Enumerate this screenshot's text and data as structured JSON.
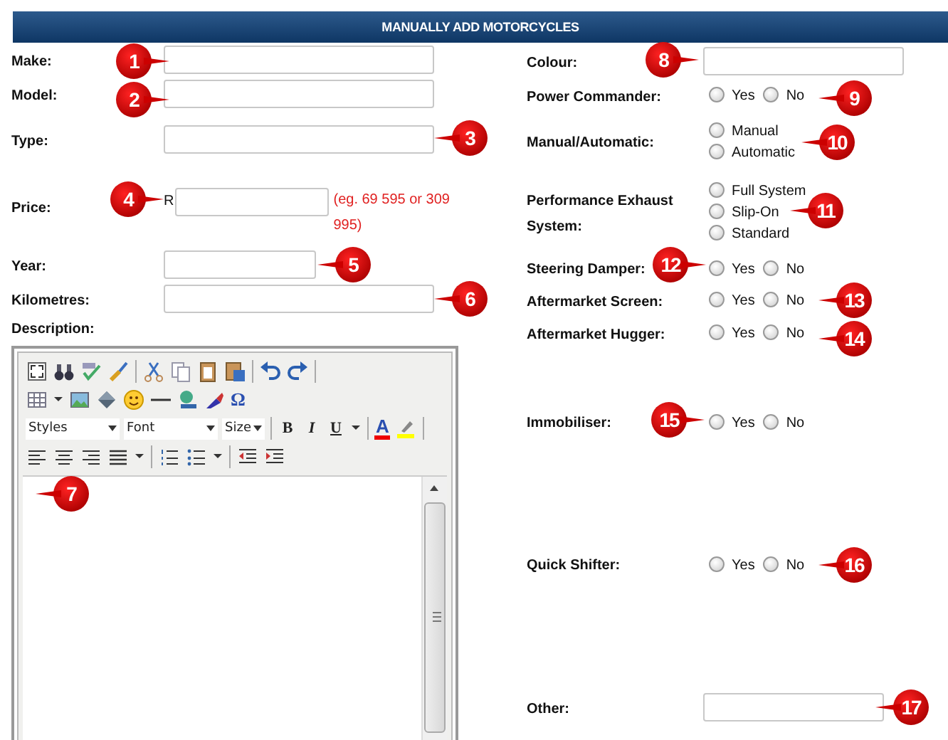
{
  "header": {
    "title": "MANUALLY ADD MOTORCYCLES"
  },
  "left_fields": [
    {
      "label": "Make:",
      "kind": "text"
    },
    {
      "label": "Model:",
      "kind": "text"
    },
    {
      "label": "Type:",
      "kind": "text"
    },
    {
      "label": "Price:",
      "kind": "price",
      "prefix": "R",
      "hint": "(eg. 69 595 or 309 995)"
    },
    {
      "label": "Year:",
      "kind": "text"
    },
    {
      "label": "Kilometres:",
      "kind": "text"
    },
    {
      "label": "Description:",
      "kind": "editor"
    }
  ],
  "editor": {
    "dropdowns": [
      "Styles",
      "Font",
      "Size"
    ],
    "format_buttons": [
      "B",
      "I",
      "U"
    ],
    "font_color": "A",
    "special_char": "Ω"
  },
  "right_fields": [
    {
      "label": "Colour:",
      "kind": "text"
    },
    {
      "label": "Power Commander:",
      "kind": "radio",
      "options": [
        {
          "label": "Yes",
          "selected": false
        },
        {
          "label": "No",
          "selected": false
        }
      ]
    },
    {
      "label": "Manual/Automatic:",
      "kind": "radio-stack",
      "options": [
        {
          "label": "Manual",
          "selected": false
        },
        {
          "label": "Automatic",
          "selected": false
        }
      ]
    },
    {
      "label": "Performance Exhaust System:",
      "kind": "radio-stack",
      "options": [
        {
          "label": "Full System",
          "selected": false
        },
        {
          "label": "Slip-On",
          "selected": false
        },
        {
          "label": "Standard",
          "selected": false
        }
      ]
    },
    {
      "label": "Steering Damper:",
      "kind": "radio",
      "options": [
        {
          "label": "Yes",
          "selected": false
        },
        {
          "label": "No",
          "selected": false
        }
      ]
    },
    {
      "label": "Aftermarket Screen:",
      "kind": "radio",
      "options": [
        {
          "label": "Yes",
          "selected": false
        },
        {
          "label": "No",
          "selected": false
        }
      ]
    },
    {
      "label": "Aftermarket Hugger:",
      "kind": "radio",
      "options": [
        {
          "label": "Yes",
          "selected": false
        },
        {
          "label": "No",
          "selected": false
        }
      ]
    },
    {
      "label": "Immobiliser:",
      "kind": "radio",
      "options": [
        {
          "label": "Yes",
          "selected": false
        },
        {
          "label": "No",
          "selected": false
        }
      ]
    },
    {
      "label": "Quick Shifter:",
      "kind": "radio",
      "options": [
        {
          "label": "Yes",
          "selected": false
        },
        {
          "label": "No",
          "selected": false
        }
      ]
    },
    {
      "label": "Other:",
      "kind": "text"
    }
  ],
  "callouts": [
    {
      "number": "1"
    },
    {
      "number": "2"
    },
    {
      "number": "3"
    },
    {
      "number": "4"
    },
    {
      "number": "5"
    },
    {
      "number": "6"
    },
    {
      "number": "7"
    },
    {
      "number": "8"
    },
    {
      "number": "9"
    },
    {
      "number": "10"
    },
    {
      "number": "11"
    },
    {
      "number": "12"
    },
    {
      "number": "13"
    },
    {
      "number": "14"
    },
    {
      "number": "15"
    },
    {
      "number": "16"
    },
    {
      "number": "17"
    }
  ]
}
